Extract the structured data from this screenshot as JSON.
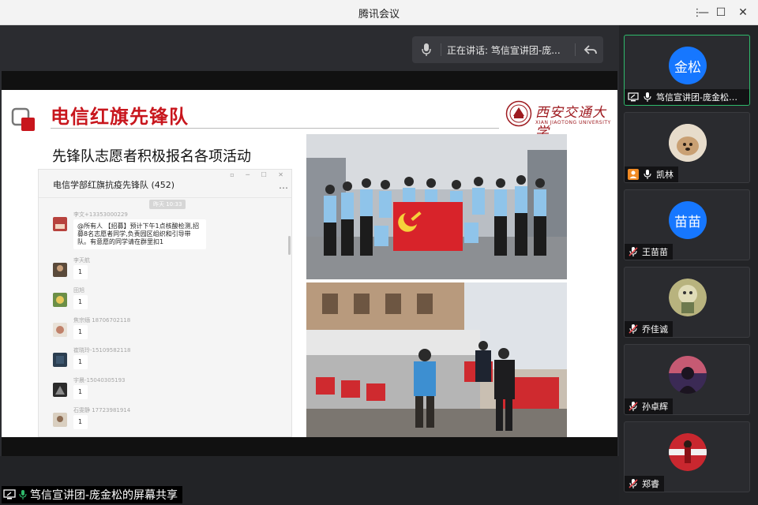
{
  "window": {
    "title": "腾讯会议",
    "more_glyph": "⋮",
    "minimize_glyph": "—",
    "maximize_glyph": "☐",
    "close_glyph": "✕"
  },
  "speaker": {
    "label": "正在讲话: ",
    "name": "笃信宣讲团-庞..."
  },
  "slide": {
    "title": "电信红旗先锋队",
    "university_cn": "西安交通大学",
    "university_en": "XIAN JIAOTONG UNIVERSITY",
    "subtitle": "先锋队志愿者积极报名各项活动",
    "chat": {
      "title": "电信学部红旗抗疫先锋队 (452)",
      "controls": "▫ ─ ☐ ✕",
      "more": "⋯",
      "time": "昨天 10:33",
      "messages": [
        {
          "sender": "李文+13353000229",
          "text": "@所有人 【招募】预计下午1点核酸检测,招募8名志愿者同学,负责园区组织和引导带队。有意愿的同学请在群里扣1"
        },
        {
          "sender": "李天航",
          "text": "1"
        },
        {
          "sender": "田旭",
          "text": "1"
        },
        {
          "sender": "焦宗缅 18706702118",
          "text": "1"
        },
        {
          "sender": "崔晓玲-15109582118",
          "text": "1"
        },
        {
          "sender": "宇晨-15040305193",
          "text": "1"
        },
        {
          "sender": "石雯静 17723981914",
          "text": "1"
        }
      ]
    }
  },
  "participants": [
    {
      "name": "笃信宣讲团-庞金松的...",
      "avatar_text": "金松",
      "avatar_color": "#1677ff",
      "status_icon": "screen-share-icon",
      "mic": "on",
      "active": true
    },
    {
      "name": "凯林",
      "avatar_text": "",
      "status_icon": "user-icon",
      "mic": "on",
      "active": false
    },
    {
      "name": "王苗苗",
      "avatar_text": "苗苗",
      "avatar_color": "#1677ff",
      "status_icon": "",
      "mic": "muted",
      "active": false
    },
    {
      "name": "乔佳诚",
      "avatar_text": "",
      "status_icon": "",
      "mic": "muted",
      "active": false
    },
    {
      "name": "孙卓辉",
      "avatar_text": "",
      "status_icon": "",
      "mic": "muted",
      "active": false
    },
    {
      "name": "郑睿",
      "avatar_text": "",
      "status_icon": "",
      "mic": "muted",
      "active": false
    }
  ],
  "share_label": "笃信宣讲团-庞金松的屏幕共享",
  "colors": {
    "accent_blue": "#1677ff",
    "active_border": "#2fba6b",
    "muted_red": "#e5484d",
    "slide_red": "#c8161d"
  }
}
